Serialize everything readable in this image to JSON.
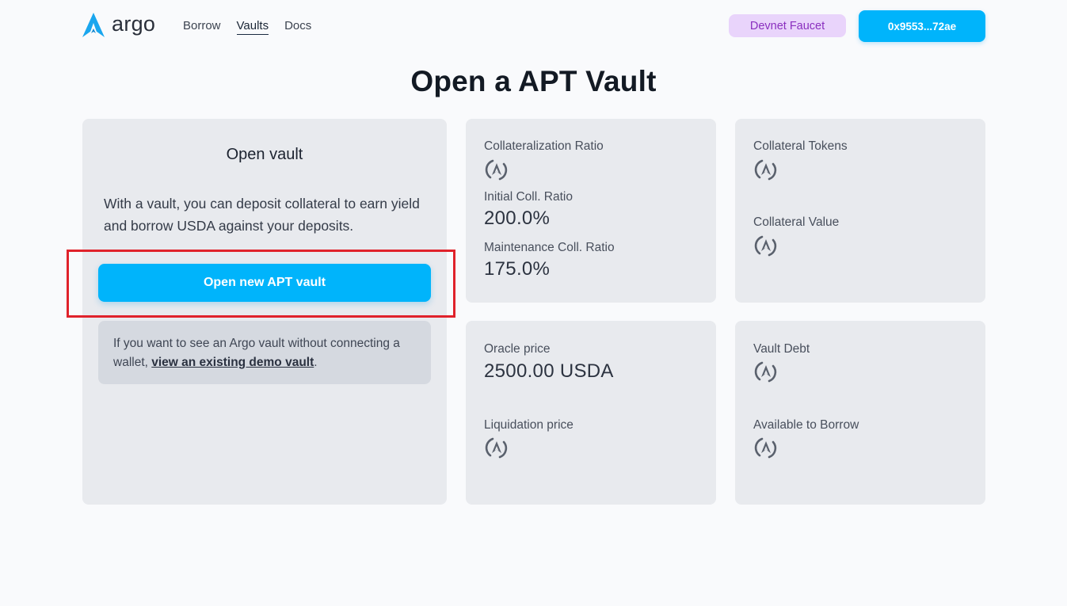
{
  "header": {
    "logo_text": "argo",
    "nav": [
      {
        "label": "Borrow",
        "active": false
      },
      {
        "label": "Vaults",
        "active": true
      },
      {
        "label": "Docs",
        "active": false
      }
    ],
    "faucet_label": "Devnet Faucet",
    "wallet_label": "0x9553...72ae"
  },
  "page_title": "Open a APT Vault",
  "open_card": {
    "title": "Open vault",
    "description": "With a vault, you can deposit collateral to earn yield and borrow USDA against your deposits.",
    "button_label": "Open new APT vault",
    "demo_note_prefix": "If you want to see an Argo vault without connecting a wallet, ",
    "demo_link": "view an existing demo vault",
    "demo_note_suffix": "."
  },
  "collateralization": {
    "label": "Collateralization Ratio",
    "initial_label": "Initial Coll. Ratio",
    "initial_value": "200.0%",
    "maintenance_label": "Maintenance Coll. Ratio",
    "maintenance_value": "175.0%"
  },
  "collateral": {
    "tokens_label": "Collateral Tokens",
    "value_label": "Collateral Value"
  },
  "price": {
    "oracle_label": "Oracle price",
    "oracle_value": "2500.00 USDA",
    "liquidation_label": "Liquidation price"
  },
  "debt": {
    "debt_label": "Vault Debt",
    "available_label": "Available to Borrow"
  },
  "icons": {
    "logo": "argo-logo-icon",
    "loading": "loading-spinner-icon"
  },
  "colors": {
    "accent": "#00b4fb",
    "faucet_bg": "#e9d4fb",
    "faucet_text": "#8a2fbf",
    "highlight": "#e0222b"
  }
}
